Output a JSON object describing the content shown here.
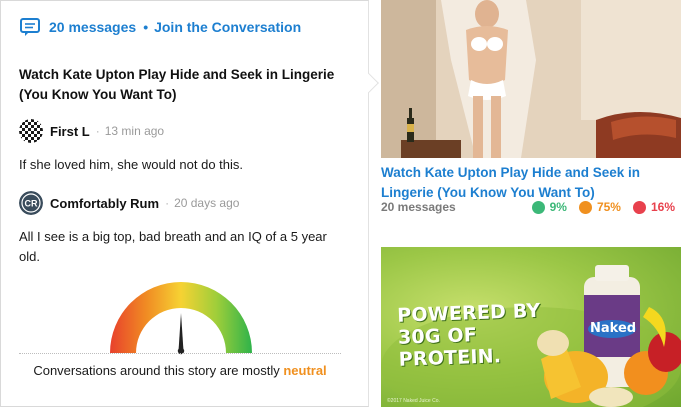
{
  "header": {
    "messages_link": "20 messages",
    "separator": "•",
    "join_link": "Join the Conversation",
    "icon": "chat-icon"
  },
  "story": {
    "title": "Watch Kate Upton Play Hide and Seek in Lingerie (You Know You Want To)"
  },
  "comments": [
    {
      "author": "First L",
      "separator": "·",
      "time": "13 min ago",
      "text": "If she loved him, she would not do this.",
      "avatar": "checkered-avatar"
    },
    {
      "author": "Comfortably Rum",
      "separator": "·",
      "time": "20 days ago",
      "text": "All I see is a big top, bad breath and an IQ of a 5 year old.",
      "avatar": "cr-monogram-avatar",
      "avatar_text": "CR"
    }
  ],
  "sentiment": {
    "prefix": "Conversations around this story are mostly ",
    "mood": "neutral",
    "gauge_level": 0.5,
    "mood_color": "#f0901f"
  },
  "related_story": {
    "title": "Watch Kate Upton Play Hide and Seek in Lingerie (You Know You Want To)",
    "messages": "20 messages",
    "reactions": [
      {
        "mood": "happy",
        "value": "9%",
        "color": "#3cb878"
      },
      {
        "mood": "neutral",
        "value": "75%",
        "color": "#f0901f"
      },
      {
        "mood": "sad",
        "value": "16%",
        "color": "#e8414d"
      }
    ]
  },
  "ad": {
    "headline_1": "POWERED BY",
    "headline_2": "30G OF PROTEIN.",
    "brand": "Naked",
    "fine_print": "©2017 Naked Juice Co."
  },
  "colors": {
    "link": "#1d7fd0",
    "border": "#d9d9d9"
  }
}
